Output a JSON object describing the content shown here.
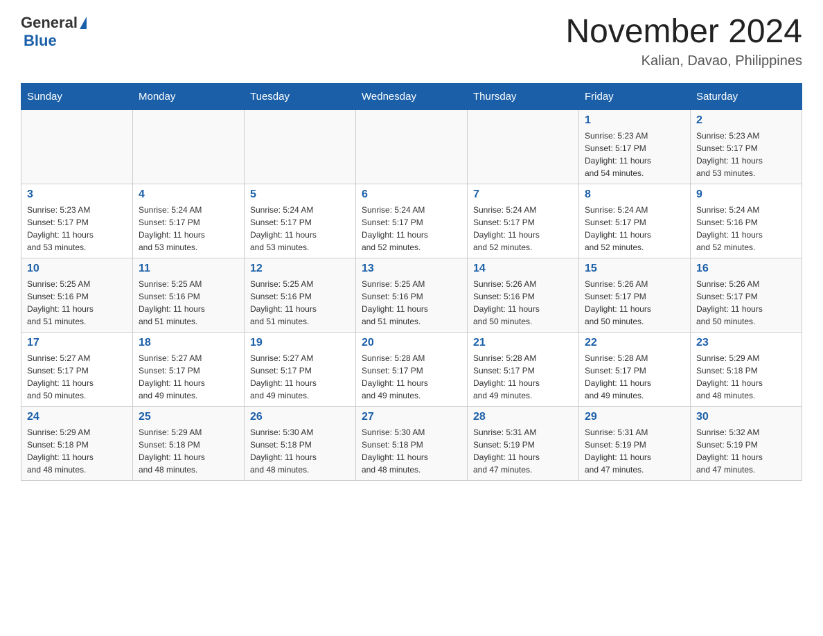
{
  "logo": {
    "text_general": "General",
    "text_blue": "Blue",
    "arrow_symbol": "▲"
  },
  "title": {
    "month_year": "November 2024",
    "location": "Kalian, Davao, Philippines"
  },
  "weekdays": [
    "Sunday",
    "Monday",
    "Tuesday",
    "Wednesday",
    "Thursday",
    "Friday",
    "Saturday"
  ],
  "weeks": [
    {
      "days": [
        {
          "number": "",
          "info": ""
        },
        {
          "number": "",
          "info": ""
        },
        {
          "number": "",
          "info": ""
        },
        {
          "number": "",
          "info": ""
        },
        {
          "number": "",
          "info": ""
        },
        {
          "number": "1",
          "info": "Sunrise: 5:23 AM\nSunset: 5:17 PM\nDaylight: 11 hours\nand 54 minutes."
        },
        {
          "number": "2",
          "info": "Sunrise: 5:23 AM\nSunset: 5:17 PM\nDaylight: 11 hours\nand 53 minutes."
        }
      ]
    },
    {
      "days": [
        {
          "number": "3",
          "info": "Sunrise: 5:23 AM\nSunset: 5:17 PM\nDaylight: 11 hours\nand 53 minutes."
        },
        {
          "number": "4",
          "info": "Sunrise: 5:24 AM\nSunset: 5:17 PM\nDaylight: 11 hours\nand 53 minutes."
        },
        {
          "number": "5",
          "info": "Sunrise: 5:24 AM\nSunset: 5:17 PM\nDaylight: 11 hours\nand 53 minutes."
        },
        {
          "number": "6",
          "info": "Sunrise: 5:24 AM\nSunset: 5:17 PM\nDaylight: 11 hours\nand 52 minutes."
        },
        {
          "number": "7",
          "info": "Sunrise: 5:24 AM\nSunset: 5:17 PM\nDaylight: 11 hours\nand 52 minutes."
        },
        {
          "number": "8",
          "info": "Sunrise: 5:24 AM\nSunset: 5:17 PM\nDaylight: 11 hours\nand 52 minutes."
        },
        {
          "number": "9",
          "info": "Sunrise: 5:24 AM\nSunset: 5:16 PM\nDaylight: 11 hours\nand 52 minutes."
        }
      ]
    },
    {
      "days": [
        {
          "number": "10",
          "info": "Sunrise: 5:25 AM\nSunset: 5:16 PM\nDaylight: 11 hours\nand 51 minutes."
        },
        {
          "number": "11",
          "info": "Sunrise: 5:25 AM\nSunset: 5:16 PM\nDaylight: 11 hours\nand 51 minutes."
        },
        {
          "number": "12",
          "info": "Sunrise: 5:25 AM\nSunset: 5:16 PM\nDaylight: 11 hours\nand 51 minutes."
        },
        {
          "number": "13",
          "info": "Sunrise: 5:25 AM\nSunset: 5:16 PM\nDaylight: 11 hours\nand 51 minutes."
        },
        {
          "number": "14",
          "info": "Sunrise: 5:26 AM\nSunset: 5:16 PM\nDaylight: 11 hours\nand 50 minutes."
        },
        {
          "number": "15",
          "info": "Sunrise: 5:26 AM\nSunset: 5:17 PM\nDaylight: 11 hours\nand 50 minutes."
        },
        {
          "number": "16",
          "info": "Sunrise: 5:26 AM\nSunset: 5:17 PM\nDaylight: 11 hours\nand 50 minutes."
        }
      ]
    },
    {
      "days": [
        {
          "number": "17",
          "info": "Sunrise: 5:27 AM\nSunset: 5:17 PM\nDaylight: 11 hours\nand 50 minutes."
        },
        {
          "number": "18",
          "info": "Sunrise: 5:27 AM\nSunset: 5:17 PM\nDaylight: 11 hours\nand 49 minutes."
        },
        {
          "number": "19",
          "info": "Sunrise: 5:27 AM\nSunset: 5:17 PM\nDaylight: 11 hours\nand 49 minutes."
        },
        {
          "number": "20",
          "info": "Sunrise: 5:28 AM\nSunset: 5:17 PM\nDaylight: 11 hours\nand 49 minutes."
        },
        {
          "number": "21",
          "info": "Sunrise: 5:28 AM\nSunset: 5:17 PM\nDaylight: 11 hours\nand 49 minutes."
        },
        {
          "number": "22",
          "info": "Sunrise: 5:28 AM\nSunset: 5:17 PM\nDaylight: 11 hours\nand 49 minutes."
        },
        {
          "number": "23",
          "info": "Sunrise: 5:29 AM\nSunset: 5:18 PM\nDaylight: 11 hours\nand 48 minutes."
        }
      ]
    },
    {
      "days": [
        {
          "number": "24",
          "info": "Sunrise: 5:29 AM\nSunset: 5:18 PM\nDaylight: 11 hours\nand 48 minutes."
        },
        {
          "number": "25",
          "info": "Sunrise: 5:29 AM\nSunset: 5:18 PM\nDaylight: 11 hours\nand 48 minutes."
        },
        {
          "number": "26",
          "info": "Sunrise: 5:30 AM\nSunset: 5:18 PM\nDaylight: 11 hours\nand 48 minutes."
        },
        {
          "number": "27",
          "info": "Sunrise: 5:30 AM\nSunset: 5:18 PM\nDaylight: 11 hours\nand 48 minutes."
        },
        {
          "number": "28",
          "info": "Sunrise: 5:31 AM\nSunset: 5:19 PM\nDaylight: 11 hours\nand 47 minutes."
        },
        {
          "number": "29",
          "info": "Sunrise: 5:31 AM\nSunset: 5:19 PM\nDaylight: 11 hours\nand 47 minutes."
        },
        {
          "number": "30",
          "info": "Sunrise: 5:32 AM\nSunset: 5:19 PM\nDaylight: 11 hours\nand 47 minutes."
        }
      ]
    }
  ]
}
